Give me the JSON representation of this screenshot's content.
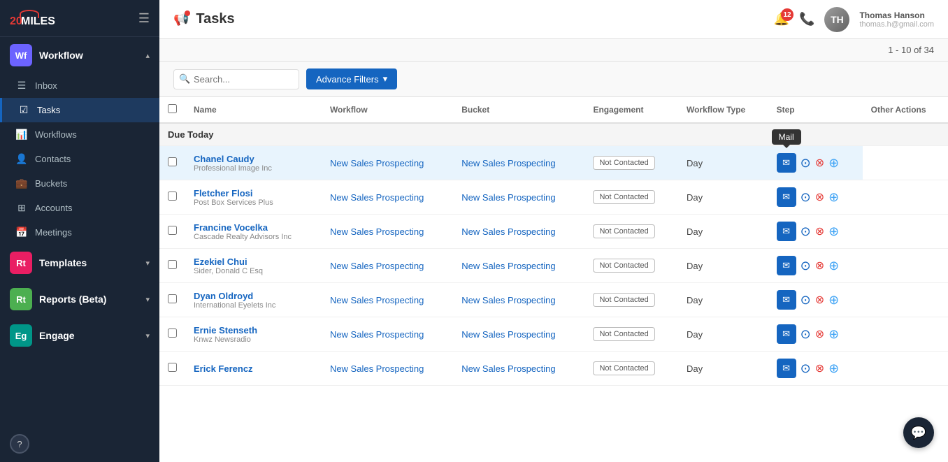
{
  "app": {
    "logo_text_20": "20",
    "logo_text_miles": "MILES"
  },
  "topbar": {
    "title": "Tasks",
    "notification_count": "12",
    "user_name": "Thomas Hanson",
    "user_email": "thomas.h@gmail.com"
  },
  "pagination": {
    "text": "1 - 10 of 34"
  },
  "filters": {
    "search_placeholder": "Search...",
    "advance_filters_label": "Advance Filters"
  },
  "table": {
    "columns": {
      "name": "Name",
      "workflow": "Workflow",
      "bucket": "Bucket",
      "engagement": "Engagement",
      "workflow_type": "Workflow Type",
      "step": "Step",
      "other_actions": "Other Actions"
    },
    "section_label": "Due Today",
    "rows": [
      {
        "id": 1,
        "contact_name": "Chanel Caudy",
        "company": "Professional Image Inc",
        "workflow": "New Sales Prospecting",
        "bucket": "New Sales Prospecting",
        "engagement": "Not Contacted",
        "workflow_type": "Day",
        "highlighted": true
      },
      {
        "id": 2,
        "contact_name": "Fletcher Flosi",
        "company": "Post Box Services Plus",
        "workflow": "New Sales Prospecting",
        "bucket": "New Sales Prospecting",
        "engagement": "Not Contacted",
        "workflow_type": "Day",
        "highlighted": false
      },
      {
        "id": 3,
        "contact_name": "Francine Vocelka",
        "company": "Cascade Realty Advisors Inc",
        "workflow": "New Sales Prospecting",
        "bucket": "New Sales Prospecting",
        "engagement": "Not Contacted",
        "workflow_type": "Day",
        "highlighted": false
      },
      {
        "id": 4,
        "contact_name": "Ezekiel Chui",
        "company": "Sider, Donald C Esq",
        "workflow": "New Sales Prospecting",
        "bucket": "New Sales Prospecting",
        "engagement": "Not Contacted",
        "workflow_type": "Day",
        "highlighted": false
      },
      {
        "id": 5,
        "contact_name": "Dyan Oldroyd",
        "company": "International Eyelets Inc",
        "workflow": "New Sales Prospecting",
        "bucket": "New Sales Prospecting",
        "engagement": "Not Contacted",
        "workflow_type": "Day",
        "highlighted": false
      },
      {
        "id": 6,
        "contact_name": "Ernie Stenseth",
        "company": "Knwz Newsradio",
        "workflow": "New Sales Prospecting",
        "bucket": "New Sales Prospecting",
        "engagement": "Not Contacted",
        "workflow_type": "Day",
        "highlighted": false
      },
      {
        "id": 7,
        "contact_name": "Erick Ferencz",
        "company": "",
        "workflow": "New Sales Prospecting",
        "bucket": "New Sales Prospecting",
        "engagement": "Not Contacted",
        "workflow_type": "Day",
        "highlighted": false
      }
    ]
  },
  "sidebar": {
    "workflow_label": "Workflow",
    "workflow_icon": "Wf",
    "items": [
      {
        "label": "Inbox",
        "icon": "inbox"
      },
      {
        "label": "Tasks",
        "icon": "check"
      },
      {
        "label": "Workflows",
        "icon": "chart"
      },
      {
        "label": "Contacts",
        "icon": "people"
      },
      {
        "label": "Buckets",
        "icon": "briefcase"
      },
      {
        "label": "Accounts",
        "icon": "grid"
      },
      {
        "label": "Meetings",
        "icon": "calendar"
      }
    ],
    "sections": [
      {
        "label": "Templates",
        "icon": "Rt",
        "color": "#e91e63"
      },
      {
        "label": "Reports (Beta)",
        "icon": "Rt",
        "color": "#4caf50"
      },
      {
        "label": "Engage",
        "icon": "Eg",
        "color": "#009688"
      }
    ],
    "help_label": "?"
  },
  "tooltip": {
    "mail": "Mail"
  },
  "icons": {
    "menu": "☰",
    "bell": "🔔",
    "megaphone": "📢",
    "phone": "📞",
    "chevron_down": "▾",
    "chevron_up": "▴",
    "search": "🔍",
    "mail": "✉",
    "play": "▶",
    "skip": "⊘",
    "clock": "🕐",
    "chat": "💬"
  }
}
